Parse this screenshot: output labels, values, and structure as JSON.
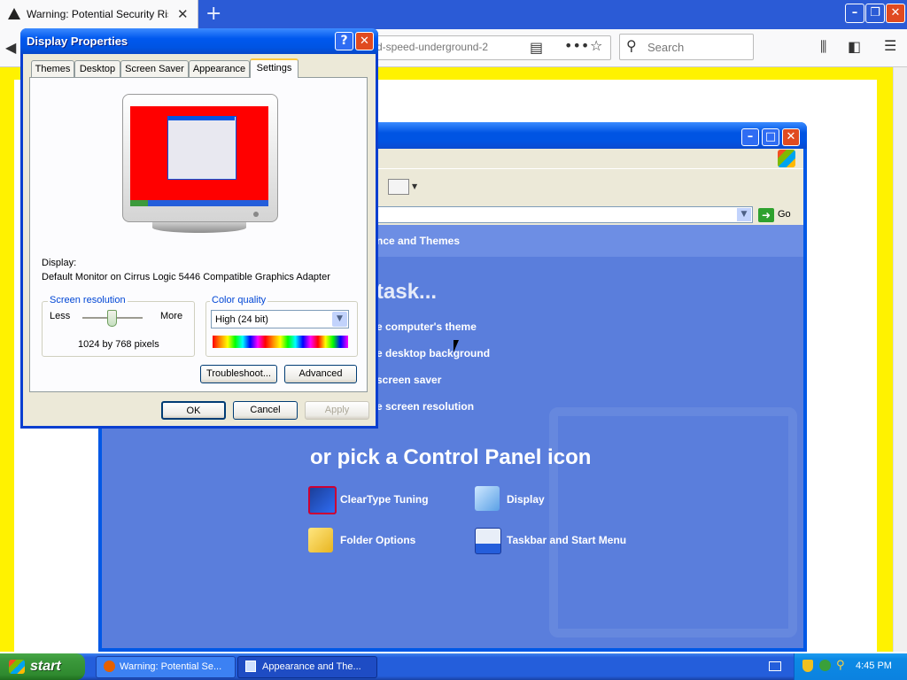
{
  "browser": {
    "tab_title": "Warning: Potential Security Risk Ahead",
    "url_fragment": "d-speed-underground-2",
    "search_placeholder": "Search"
  },
  "cp_window": {
    "breadcrumb": "nce and Themes",
    "pick_task": "a task...",
    "tasks": [
      "e computer's theme",
      "e desktop background",
      "screen saver",
      "e screen resolution"
    ],
    "pick_icon": "or pick a Control Panel icon",
    "icons": [
      "ClearType Tuning",
      "Display",
      "Folder Options",
      "Taskbar and Start Menu"
    ],
    "go_label": "Go"
  },
  "dialog": {
    "title": "Display Properties",
    "tabs": [
      "Themes",
      "Desktop",
      "Screen Saver",
      "Appearance",
      "Settings"
    ],
    "active_tab": "Settings",
    "display_label": "Display:",
    "display_value": "Default Monitor on Cirrus Logic 5446 Compatible Graphics Adapter",
    "resolution": {
      "legend": "Screen resolution",
      "less": "Less",
      "more": "More",
      "value": "1024 by 768 pixels",
      "slider_fraction": 0.5
    },
    "color_quality": {
      "legend": "Color quality",
      "selected": "High (24 bit)"
    },
    "buttons": {
      "troubleshoot": "Troubleshoot...",
      "advanced": "Advanced",
      "ok": "OK",
      "cancel": "Cancel",
      "apply": "Apply"
    }
  },
  "taskbar": {
    "start": "start",
    "tasks": [
      "Warning: Potential Se...",
      "Appearance and The..."
    ],
    "clock": "4:45 PM"
  }
}
